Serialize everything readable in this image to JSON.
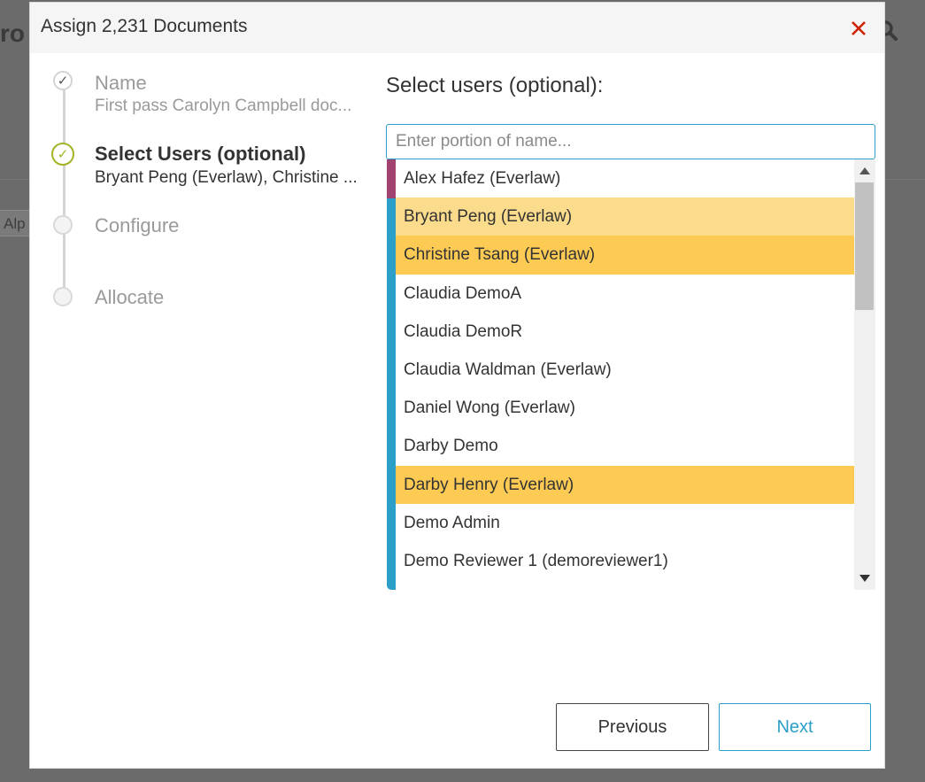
{
  "background": {
    "title_fragment": "ro",
    "chip_fragment": "Alp"
  },
  "modal": {
    "title": "Assign 2,231 Documents",
    "close_icon": "close-icon"
  },
  "steps": [
    {
      "title": "Name",
      "subtitle": "First pass Carolyn Campbell doc...",
      "state": "done"
    },
    {
      "title": "Select Users (optional)",
      "subtitle": "Bryant Peng (Everlaw), Christine ...",
      "state": "active"
    },
    {
      "title": "Configure",
      "subtitle": "",
      "state": "todo"
    },
    {
      "title": "Allocate",
      "subtitle": "",
      "state": "todo"
    }
  ],
  "panel": {
    "heading": "Select users (optional):",
    "search_placeholder": "Enter portion of name..."
  },
  "users": [
    {
      "name": "Alex Hafez (Everlaw)",
      "highlight": "none"
    },
    {
      "name": "Bryant Peng (Everlaw)",
      "highlight": "light"
    },
    {
      "name": "Christine Tsang (Everlaw)",
      "highlight": "strong"
    },
    {
      "name": "Claudia DemoA",
      "highlight": "none"
    },
    {
      "name": "Claudia DemoR",
      "highlight": "none"
    },
    {
      "name": "Claudia Waldman (Everlaw)",
      "highlight": "none"
    },
    {
      "name": "Daniel Wong (Everlaw)",
      "highlight": "none"
    },
    {
      "name": "Darby Demo",
      "highlight": "none"
    },
    {
      "name": "Darby Henry (Everlaw)",
      "highlight": "strong"
    },
    {
      "name": "Demo Admin",
      "highlight": "none"
    },
    {
      "name": "Demo Reviewer 1 (demoreviewer1)",
      "highlight": "none"
    }
  ],
  "footer": {
    "previous_label": "Previous",
    "next_label": "Next"
  },
  "colors": {
    "accent": "#2c9fc9",
    "active_step": "#a3b325",
    "close": "#cc2200",
    "selected_light": "#fbdb8c",
    "selected_strong": "#fdcb54",
    "first_row_marker": "#a1426f"
  }
}
